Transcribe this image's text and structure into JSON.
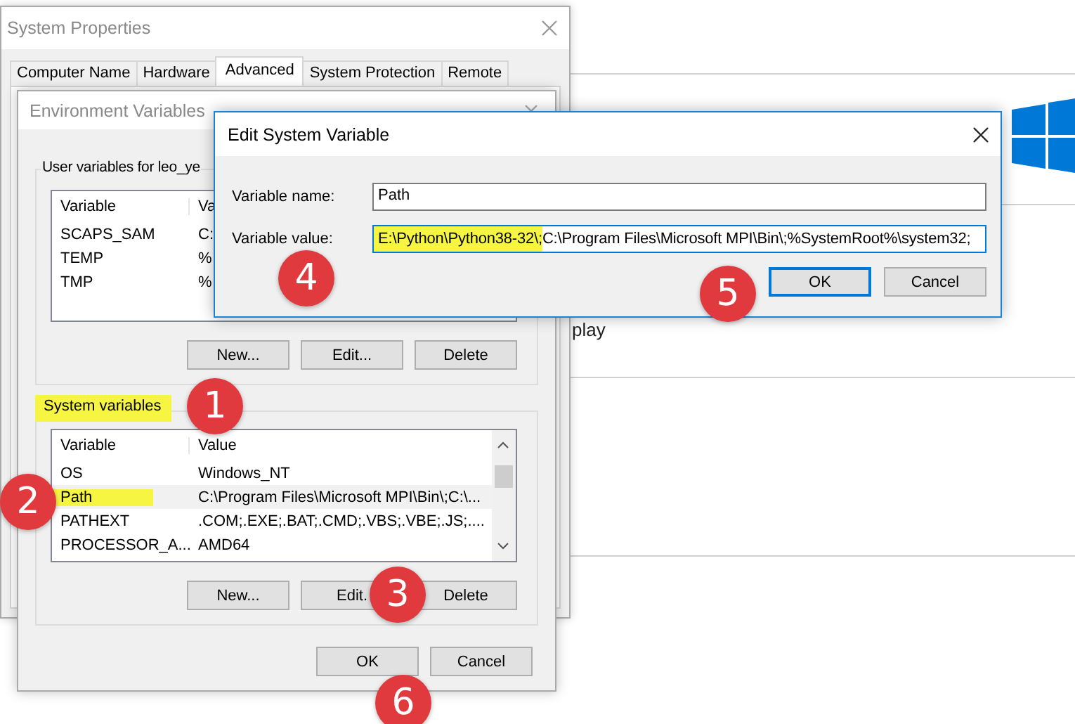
{
  "background": {
    "partial_text": "play"
  },
  "system_properties": {
    "title": "System Properties",
    "tabs": [
      {
        "label": "Computer Name",
        "selected": false
      },
      {
        "label": "Hardware",
        "selected": false
      },
      {
        "label": "Advanced",
        "selected": true
      },
      {
        "label": "System Protection",
        "selected": false
      },
      {
        "label": "Remote",
        "selected": false
      }
    ]
  },
  "environment_variables": {
    "title": "Environment Variables",
    "user_group": {
      "label": "User variables for leo_ye",
      "highlighted": false,
      "columns": [
        "Variable",
        "Va"
      ],
      "rows": [
        {
          "variable": "SCAPS_SAM",
          "value": "C:",
          "selected": false,
          "highlighted": false
        },
        {
          "variable": "TEMP",
          "value": "%",
          "selected": false,
          "highlighted": false
        },
        {
          "variable": "TMP",
          "value": "%",
          "selected": false,
          "highlighted": false
        }
      ],
      "buttons": [
        "New...",
        "Edit...",
        "Delete"
      ]
    },
    "system_group": {
      "label": "System variables",
      "highlighted": true,
      "columns": [
        "Variable",
        "Value"
      ],
      "rows": [
        {
          "variable": "OS",
          "value": "Windows_NT",
          "selected": false,
          "highlighted": false
        },
        {
          "variable": "Path",
          "value": "C:\\Program Files\\Microsoft MPI\\Bin\\;C:\\...",
          "selected": true,
          "highlighted": true
        },
        {
          "variable": "PATHEXT",
          "value": ".COM;.EXE;.BAT;.CMD;.VBS;.VBE;.JS;....",
          "selected": false,
          "highlighted": false
        },
        {
          "variable": "PROCESSOR_A...",
          "value": "AMD64",
          "selected": false,
          "highlighted": false
        }
      ],
      "buttons": [
        "New...",
        "Edit.",
        "Delete"
      ]
    },
    "buttons": [
      "OK",
      "Cancel"
    ]
  },
  "edit_dialog": {
    "title": "Edit System Variable",
    "name_label": "Variable name:",
    "name_value": "Path",
    "value_label": "Variable value:",
    "value_selected": "E:\\Python\\Python38-32\\;",
    "value_rest": "C:\\Program Files\\Microsoft MPI\\Bin\\;%SystemRoot%\\system32;",
    "buttons": [
      {
        "label": "OK",
        "default": true
      },
      {
        "label": "Cancel",
        "default": false
      }
    ]
  },
  "step_badges": [
    "1",
    "2",
    "3",
    "4",
    "5",
    "6"
  ]
}
